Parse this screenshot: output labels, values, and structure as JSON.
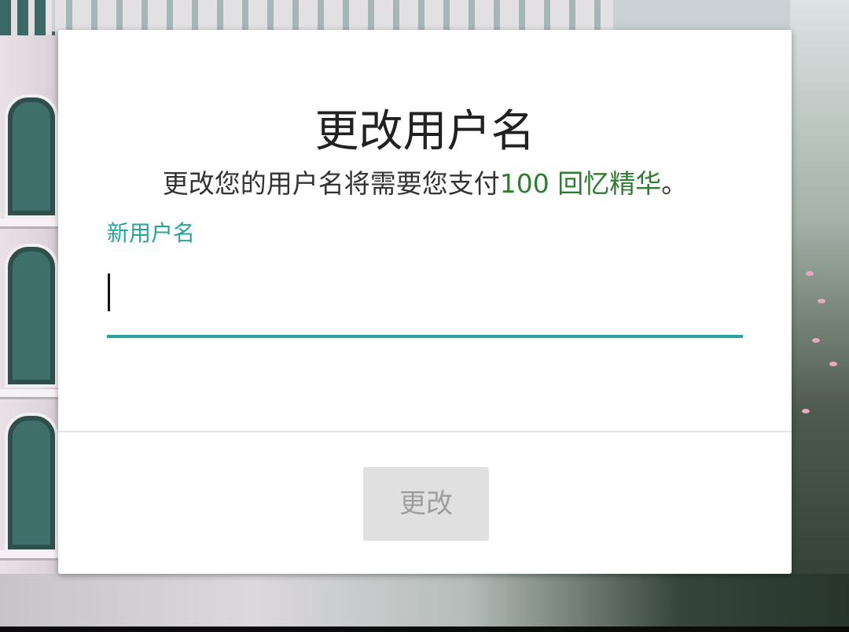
{
  "dialog": {
    "title": "更改用户名",
    "description": {
      "text": "更改您的用户名将需要您支付",
      "cost": "100 回忆精华",
      "suffix": "。"
    },
    "field": {
      "label": "新用户名",
      "value": ""
    },
    "button": {
      "label": "更改",
      "state": "disabled"
    }
  },
  "colors": {
    "accent": "#26a69a",
    "cost": "#2e7d32",
    "button_bg": "#e0e0e0",
    "button_text": "#9e9e9e"
  }
}
